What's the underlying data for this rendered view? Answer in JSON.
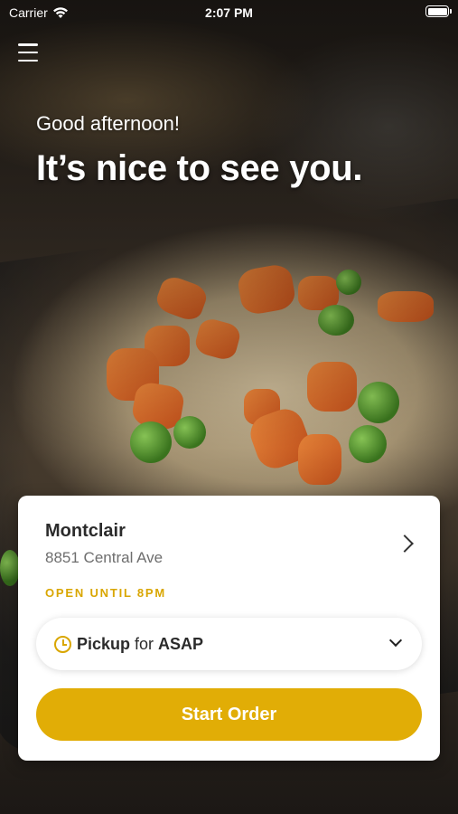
{
  "status_bar": {
    "carrier": "Carrier",
    "time": "2:07 PM"
  },
  "header": {
    "greeting": "Good afternoon!",
    "headline": "It’s nice to see you."
  },
  "location": {
    "name": "Montclair",
    "address": "8851 Central Ave",
    "hours": "OPEN UNTIL 8PM"
  },
  "order_mode": {
    "method": "Pickup",
    "connector": "for",
    "time": "ASAP"
  },
  "actions": {
    "start_order": "Start Order"
  },
  "colors": {
    "accent": "#E1AD06",
    "hours_text": "#D9A600"
  },
  "icons": [
    "wifi-icon",
    "battery-icon",
    "menu-icon",
    "chevron-right-icon",
    "clock-icon",
    "chevron-down-icon"
  ]
}
